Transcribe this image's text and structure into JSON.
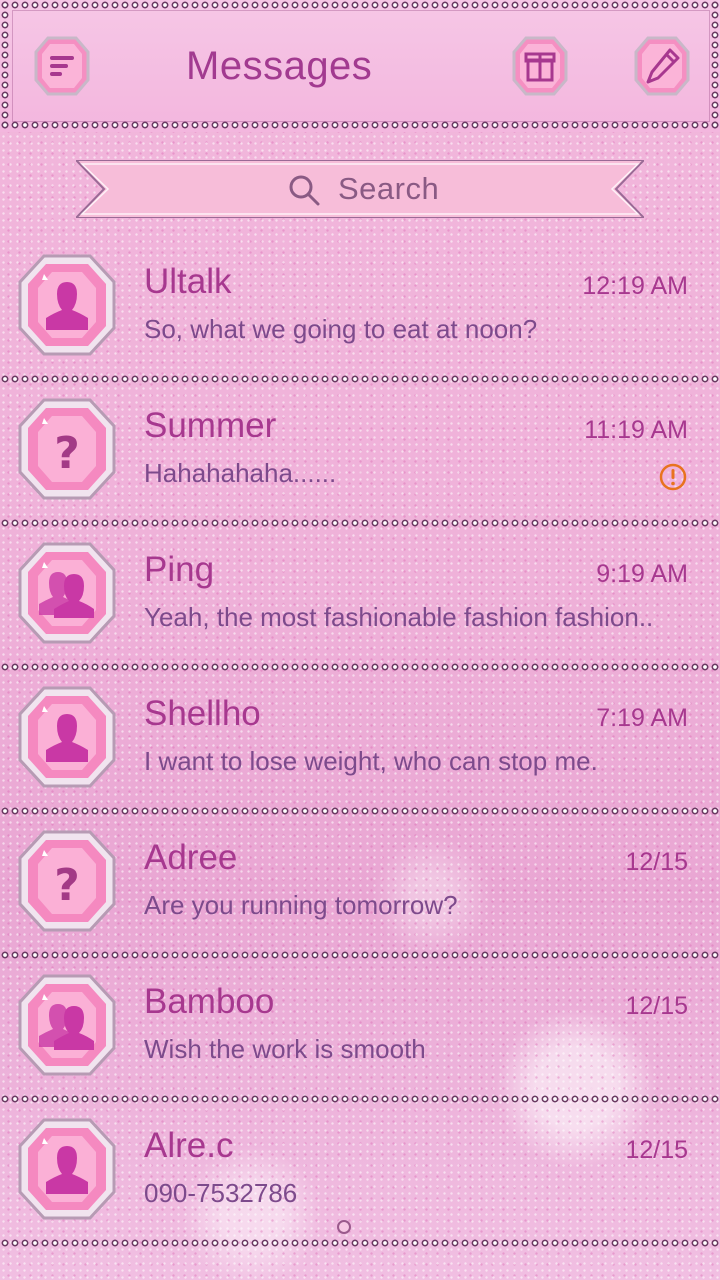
{
  "header": {
    "title": "Messages",
    "menu_icon": "menu-icon",
    "gift_icon": "gift-icon",
    "compose_icon": "pencil-icon"
  },
  "search": {
    "placeholder": "Search",
    "icon": "search-icon"
  },
  "conversations": [
    {
      "name": "Ultalk",
      "time": "12:19 AM",
      "preview": "So, what we going to eat at noon?",
      "avatar": "person-icon",
      "warning": false
    },
    {
      "name": "Summer",
      "time": "11:19 AM",
      "preview": "Hahahahaha......",
      "avatar": "question-icon",
      "warning": true
    },
    {
      "name": "Ping",
      "time": "9:19 AM",
      "preview": "Yeah, the most fashionable fashion fashion..",
      "avatar": "group-icon",
      "warning": false
    },
    {
      "name": "Shellho",
      "time": "7:19 AM",
      "preview": "I want to lose weight, who can stop me.",
      "avatar": "person-icon",
      "warning": false
    },
    {
      "name": "Adree",
      "time": "12/15",
      "preview": "Are you running tomorrow?",
      "avatar": "question-icon",
      "warning": false
    },
    {
      "name": "Bamboo",
      "time": "12/15",
      "preview": "Wish the work is smooth",
      "avatar": "group-icon",
      "warning": false
    },
    {
      "name": "Alre.c",
      "time": "12/15",
      "preview": "090-7532786",
      "avatar": "person-icon",
      "warning": false
    }
  ],
  "colors": {
    "accent": "#a7388f",
    "preview_text": "#7d4a8c",
    "warning": "#e8731e",
    "search_ribbon": "#f7bdd9"
  }
}
